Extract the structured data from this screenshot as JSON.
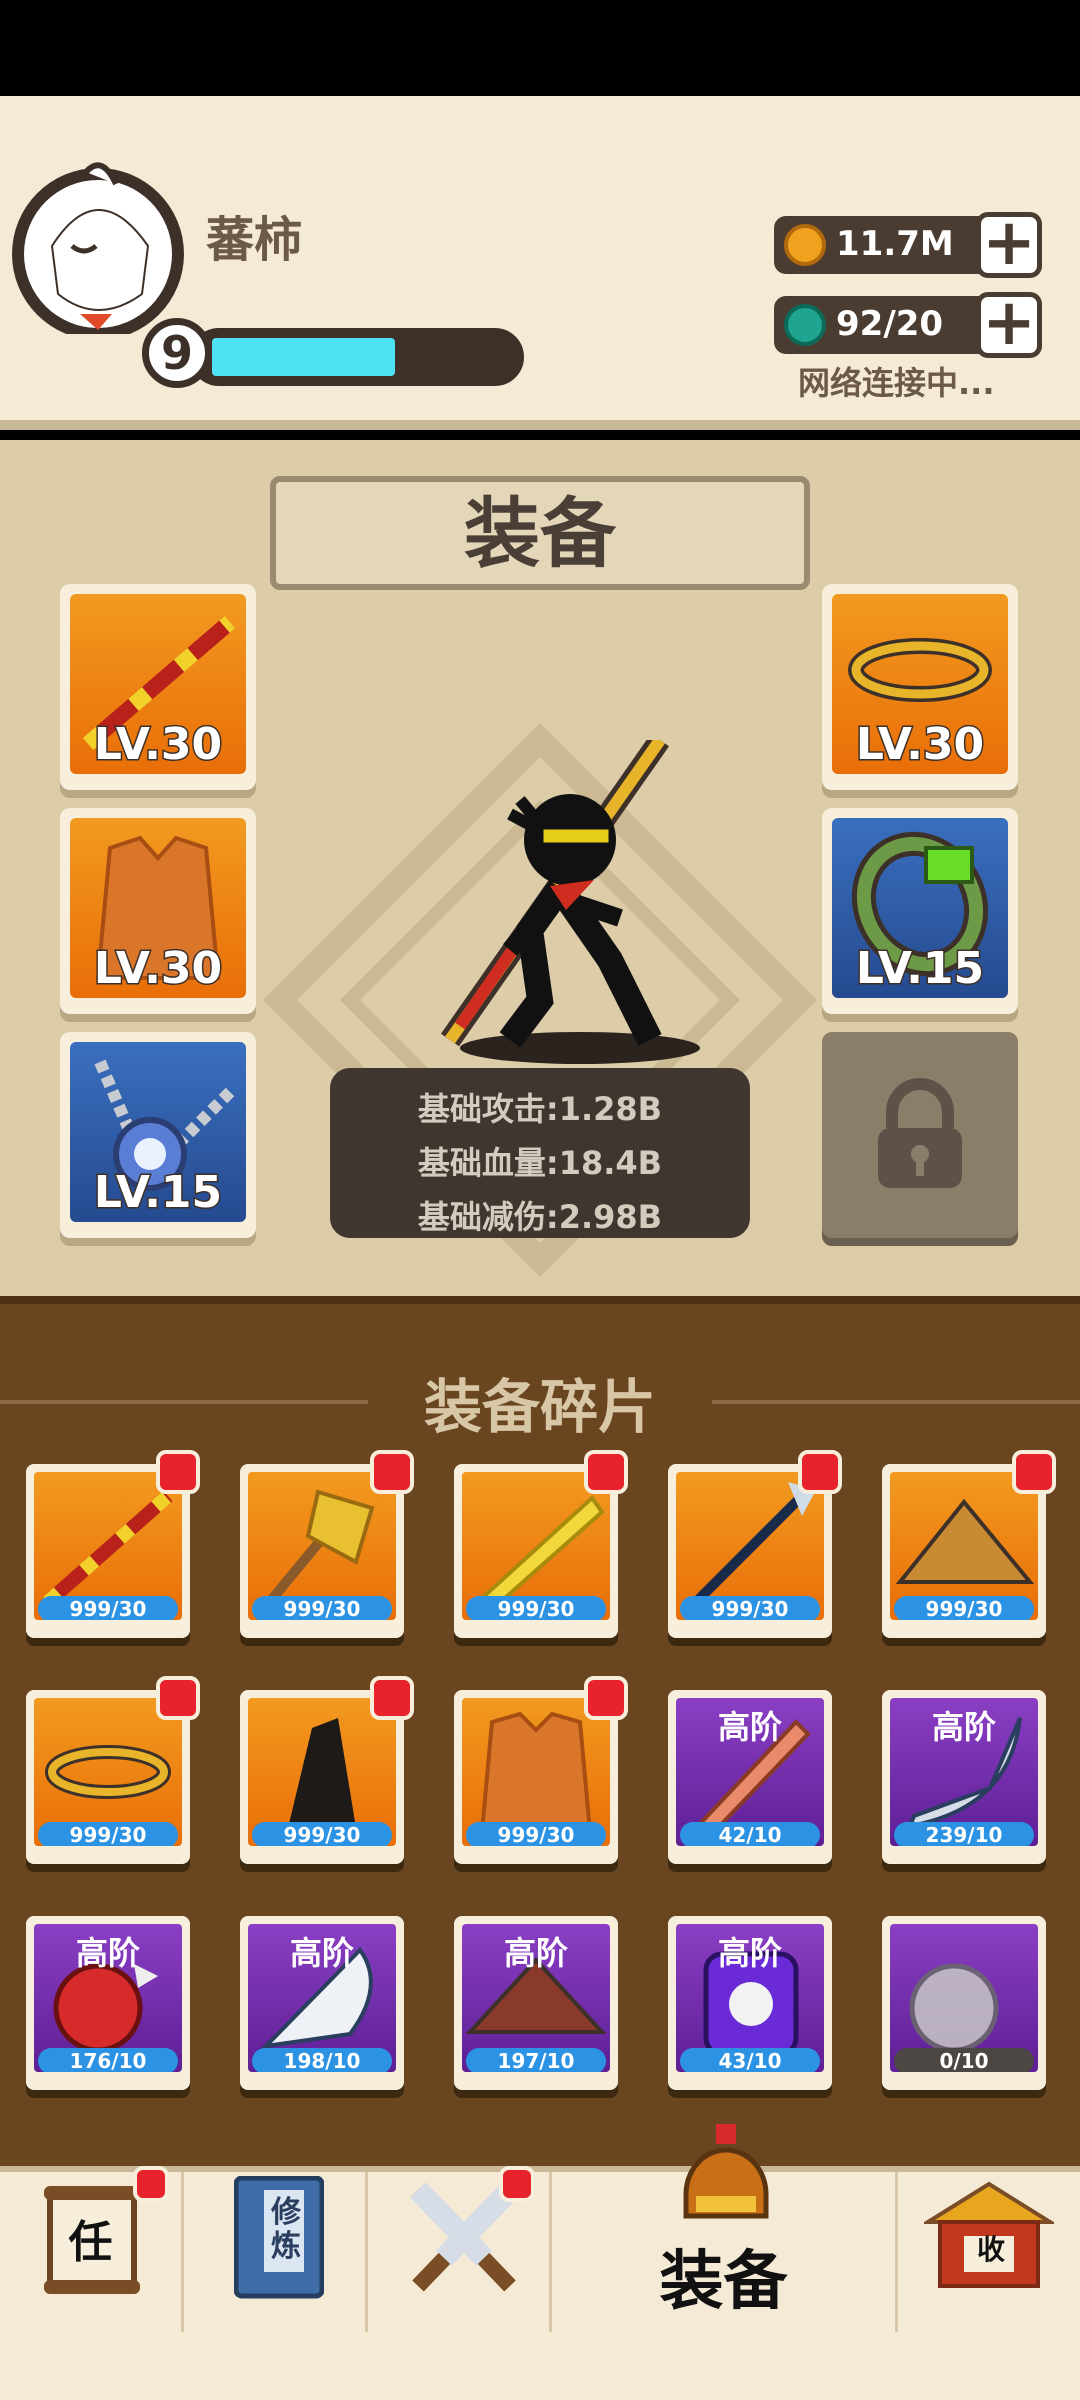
{
  "player": {
    "name": "蕃柿",
    "level": "9",
    "xp_fraction": 0.61
  },
  "resources": {
    "coins": "11.7M",
    "gems": "92/20",
    "network_status": "网络连接中..."
  },
  "equip_section": {
    "title": "装备",
    "left_slots": [
      {
        "item": "staff",
        "level": "LV.30",
        "color": "orange"
      },
      {
        "item": "armor-vest",
        "level": "LV.30",
        "color": "orange"
      },
      {
        "item": "necklace",
        "level": "LV.15",
        "color": "blue"
      }
    ],
    "right_slots": [
      {
        "item": "headband",
        "level": "LV.30",
        "color": "orange"
      },
      {
        "item": "bracelet",
        "level": "LV.15",
        "color": "blue"
      }
    ],
    "locked_slot": "lock-icon",
    "stats": [
      "基础攻击:1.28B",
      "基础血量:18.4B",
      "基础减伤:2.98B"
    ]
  },
  "fragments": {
    "title": "装备碎片",
    "items": [
      {
        "item": "staff",
        "count": "999/30",
        "color": "orange",
        "badge": true
      },
      {
        "item": "axe",
        "count": "999/30",
        "color": "orange",
        "badge": true
      },
      {
        "item": "blade",
        "count": "999/30",
        "color": "orange",
        "badge": true
      },
      {
        "item": "spear",
        "count": "999/30",
        "color": "orange",
        "badge": true
      },
      {
        "item": "straw-hat",
        "count": "999/30",
        "color": "orange",
        "badge": true
      },
      {
        "item": "headband",
        "count": "999/30",
        "color": "orange",
        "badge": true
      },
      {
        "item": "cape",
        "count": "999/30",
        "color": "orange",
        "badge": true
      },
      {
        "item": "armor-vest",
        "count": "999/30",
        "color": "orange",
        "badge": true
      },
      {
        "item": "sword",
        "count": "42/10",
        "color": "purple",
        "grade": "高阶"
      },
      {
        "item": "sabre",
        "count": "239/10",
        "color": "purple",
        "grade": "高阶"
      },
      {
        "item": "spiked-gauntlet",
        "count": "176/10",
        "color": "purple",
        "grade": "高阶"
      },
      {
        "item": "machete",
        "count": "198/10",
        "color": "purple",
        "grade": "高阶"
      },
      {
        "item": "hat",
        "count": "197/10",
        "color": "purple",
        "grade": "高阶"
      },
      {
        "item": "chest-armor",
        "count": "43/10",
        "color": "purple",
        "grade": "高阶"
      },
      {
        "item": "gauntlet-gray",
        "count": "0/10",
        "color": "purple",
        "locked": true
      }
    ]
  },
  "nav": [
    {
      "label": "任",
      "icon": "scroll-icon"
    },
    {
      "label": "修炼",
      "icon": "book-icon"
    },
    {
      "label": "",
      "icon": "crossed-swords-icon"
    },
    {
      "label": "装备",
      "icon": "helmet-icon"
    },
    {
      "label": "收",
      "icon": "pagoda-icon"
    }
  ]
}
